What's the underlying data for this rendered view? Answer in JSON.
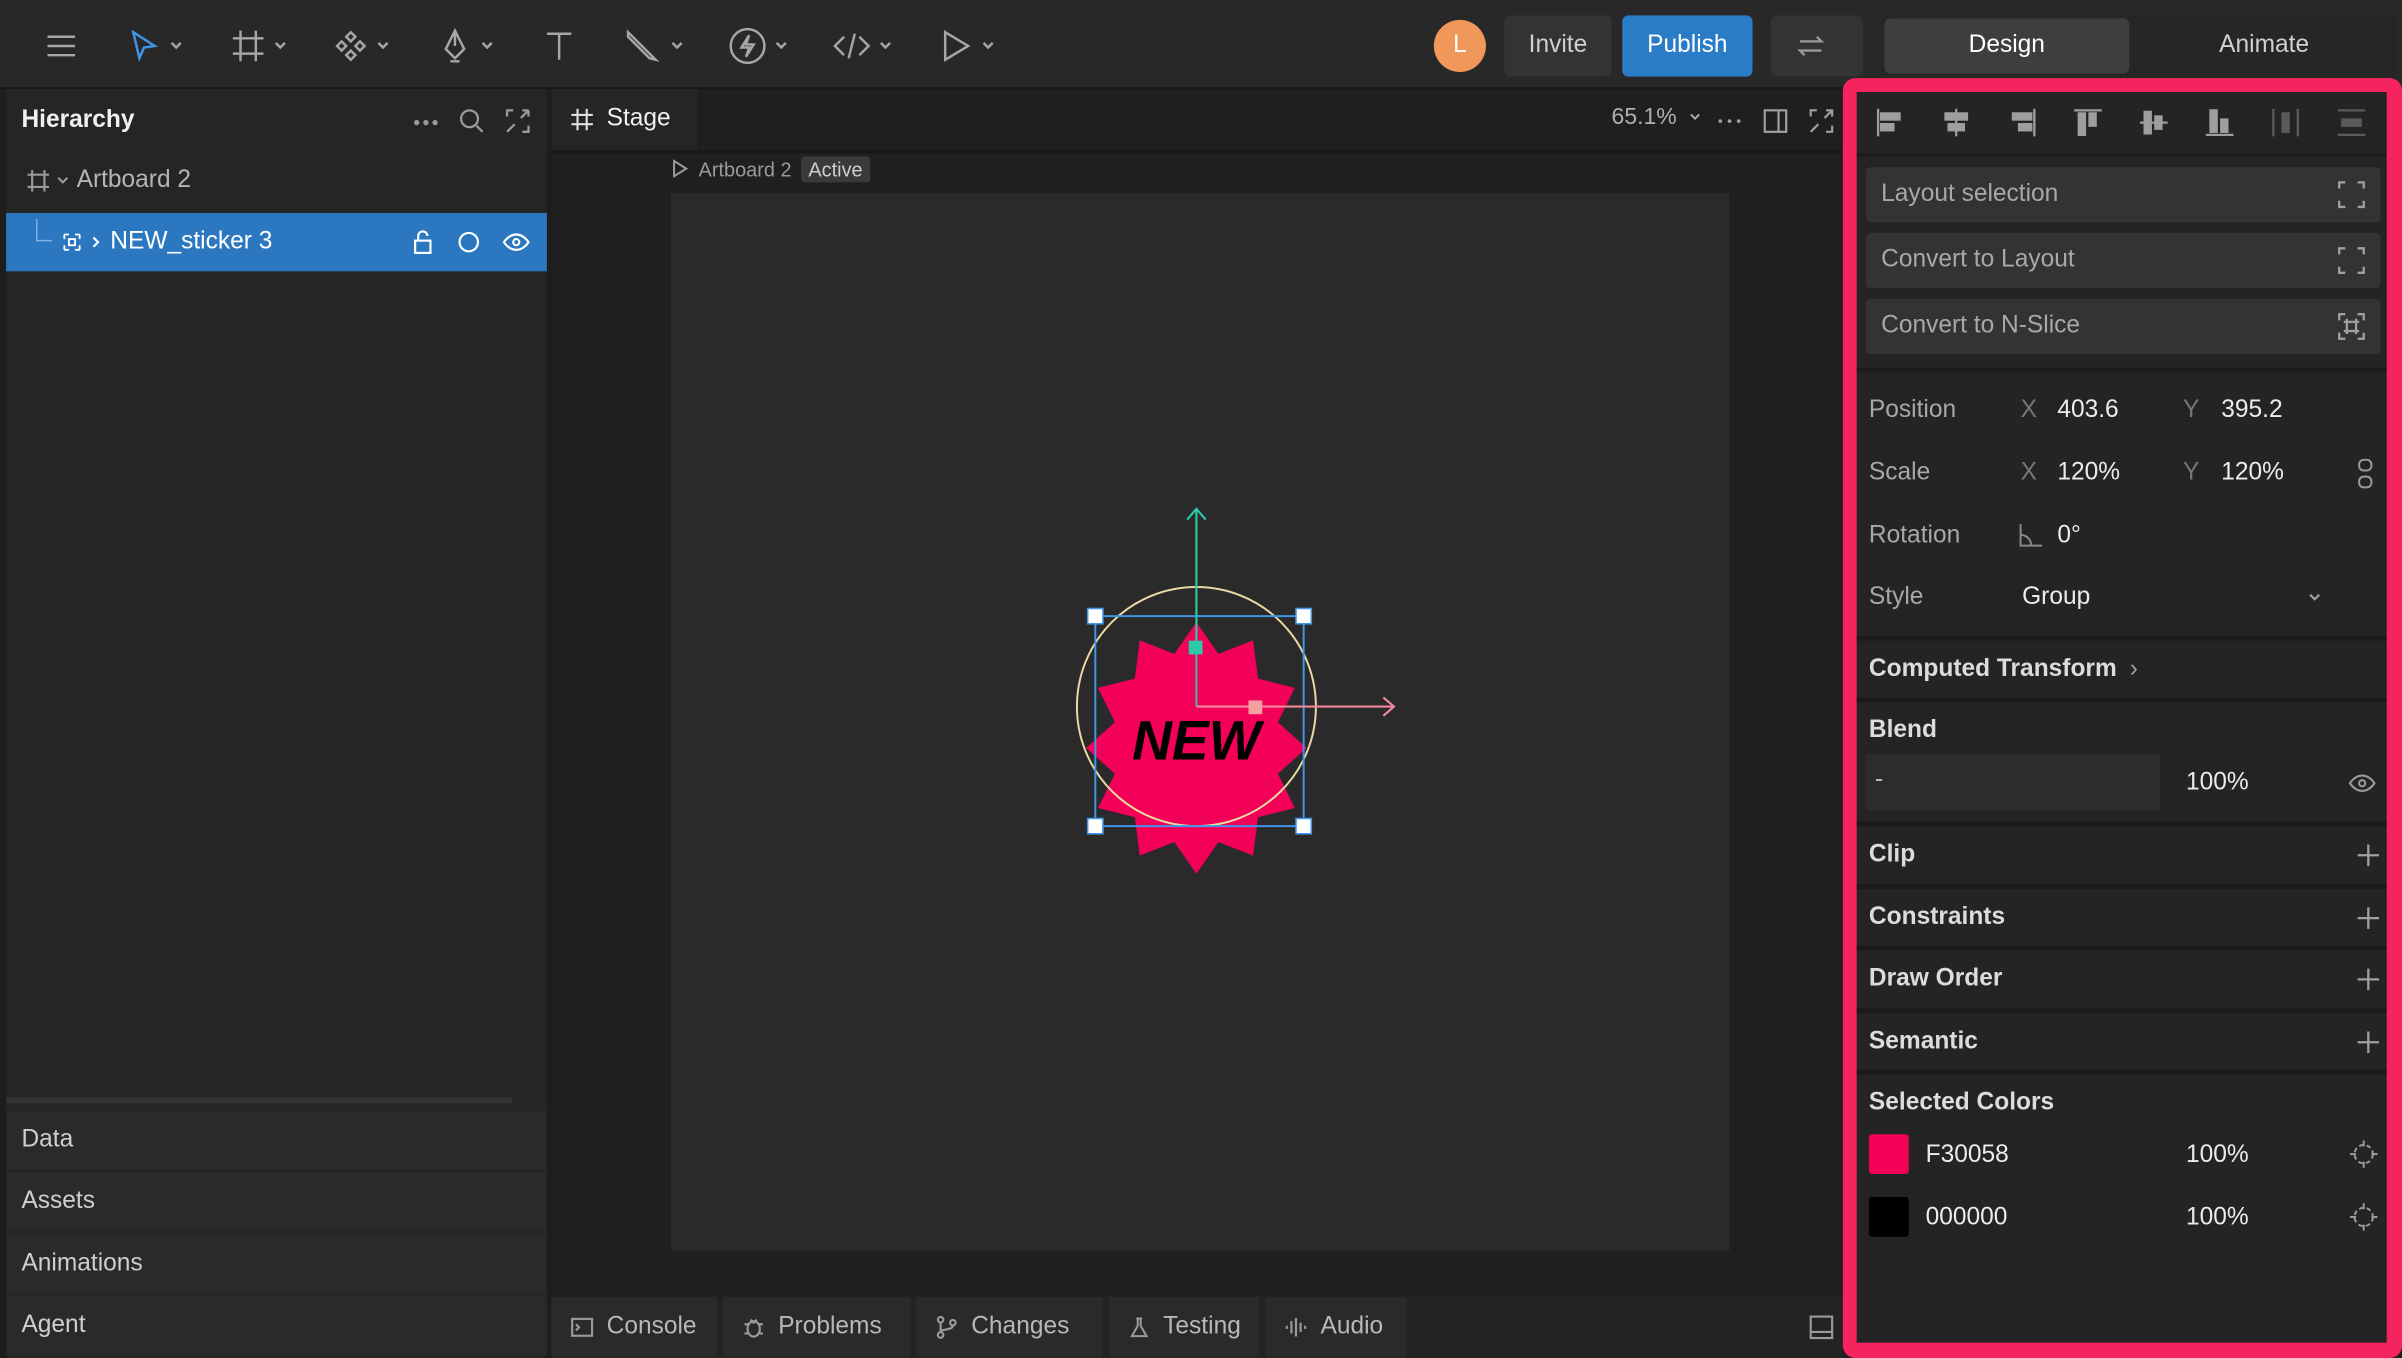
{
  "toolbar": {
    "avatar_initial": "L",
    "invite_label": "Invite",
    "publish_label": "Publish",
    "mode_tabs": [
      "Design",
      "Animate"
    ]
  },
  "hierarchy": {
    "title": "Hierarchy",
    "items": [
      {
        "label": "Artboard 2"
      },
      {
        "label": "NEW_sticker 3"
      }
    ],
    "sections": [
      "Data",
      "Assets",
      "Animations",
      "Agent"
    ]
  },
  "stage": {
    "tab_label": "Stage",
    "zoom": "65.1%",
    "breadcrumb": "Artboard 2",
    "breadcrumb_badge": "Active",
    "sticker_text": "NEW",
    "sticker_color": "#F30058"
  },
  "bottom_tabs": [
    "Console",
    "Problems",
    "Changes",
    "Testing",
    "Audio"
  ],
  "design": {
    "actions": [
      "Layout selection",
      "Convert to Layout",
      "Convert to N-Slice"
    ],
    "position": {
      "label": "Position",
      "x_axis": "X",
      "x": "403.6",
      "y_axis": "Y",
      "y": "395.2"
    },
    "scale": {
      "label": "Scale",
      "x_axis": "X",
      "x": "120%",
      "y_axis": "Y",
      "y": "120%"
    },
    "rotation": {
      "label": "Rotation",
      "value": "0°"
    },
    "style": {
      "label": "Style",
      "value": "Group"
    },
    "computed_transform": "Computed Transform",
    "blend": {
      "title": "Blend",
      "mode": "-",
      "opacity": "100%"
    },
    "sections": [
      "Clip",
      "Constraints",
      "Draw Order",
      "Semantic"
    ],
    "selected_colors": {
      "title": "Selected Colors",
      "items": [
        {
          "hex": "F30058",
          "opacity": "100%",
          "swatch": "#F30058"
        },
        {
          "hex": "000000",
          "opacity": "100%",
          "swatch": "#000000"
        }
      ]
    }
  },
  "colors": {
    "accent": "#2A7CC7",
    "highlight_border": "#F5245E",
    "avatar": "#F0975A"
  }
}
